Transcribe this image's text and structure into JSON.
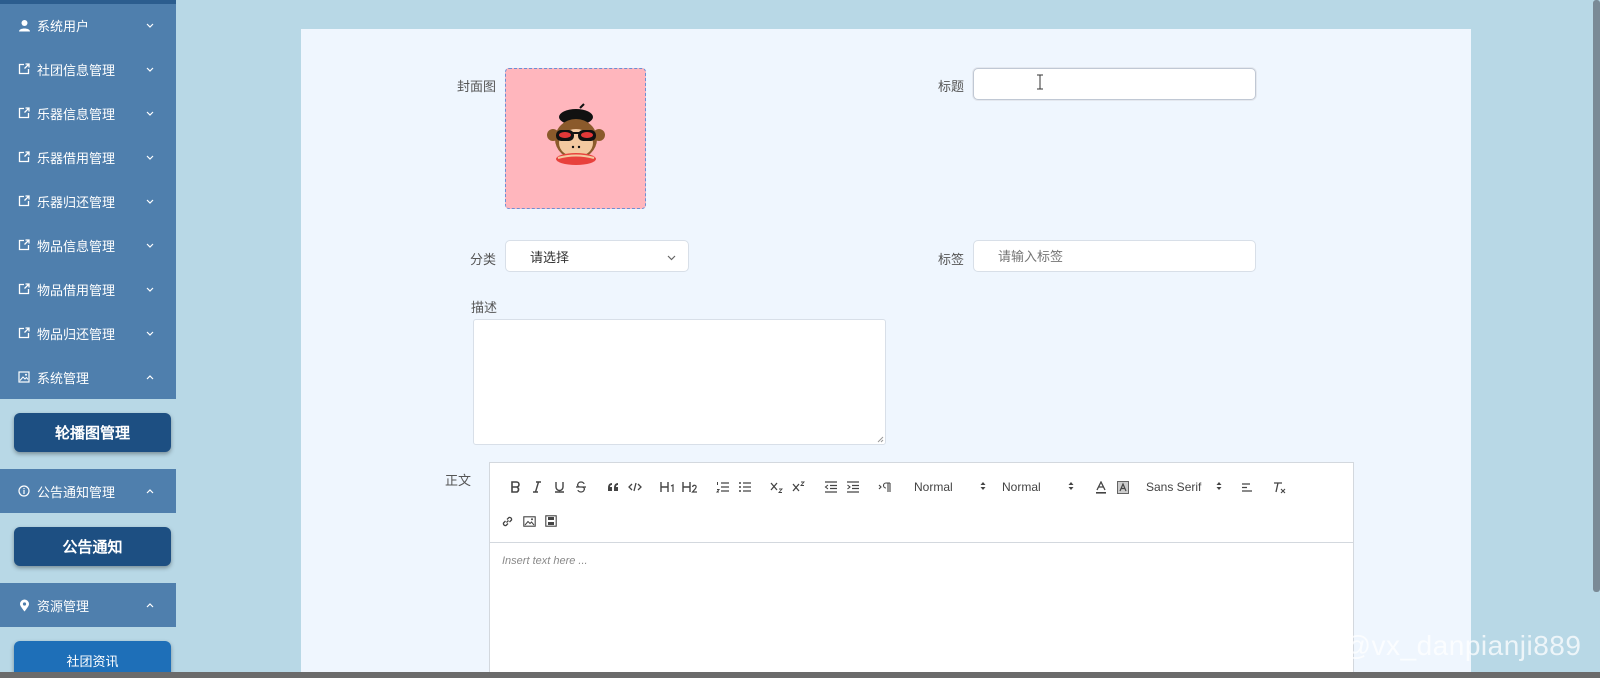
{
  "sidebar": {
    "items": [
      {
        "label": "系统用户",
        "icon": "user-icon",
        "chevron": "down"
      },
      {
        "label": "社团信息管理",
        "icon": "external-link-icon",
        "chevron": "down"
      },
      {
        "label": "乐器信息管理",
        "icon": "external-link-icon",
        "chevron": "down"
      },
      {
        "label": "乐器借用管理",
        "icon": "external-link-icon",
        "chevron": "down"
      },
      {
        "label": "乐器归还管理",
        "icon": "external-link-icon",
        "chevron": "down"
      },
      {
        "label": "物品信息管理",
        "icon": "external-link-icon",
        "chevron": "down"
      },
      {
        "label": "物品借用管理",
        "icon": "external-link-icon",
        "chevron": "down"
      },
      {
        "label": "物品归还管理",
        "icon": "external-link-icon",
        "chevron": "down"
      },
      {
        "label": "系统管理",
        "icon": "picture-icon",
        "chevron": "up"
      },
      {
        "label": "公告通知管理",
        "icon": "info-circle-icon",
        "chevron": "up"
      },
      {
        "label": "资源管理",
        "icon": "location-pin-icon",
        "chevron": "up"
      }
    ],
    "submenu": {
      "carousel": "轮播图管理",
      "notice": "公告通知",
      "news": "社团资讯"
    }
  },
  "form": {
    "cover_label": "封面图",
    "title_label": "标题",
    "title_value": "",
    "category_label": "分类",
    "category_value": "请选择",
    "tags_label": "标签",
    "tags_placeholder": "请输入标签",
    "description_label": "描述",
    "description_value": "",
    "body_label": "正文"
  },
  "editor": {
    "pickers": {
      "header": "Normal",
      "size": "Normal",
      "font": "Sans Serif"
    },
    "placeholder": "Insert text here ..."
  },
  "watermark": "CSDN @vx_danpianji889",
  "colors": {
    "sidebar_bg": "#4f7fad",
    "page_bg": "#b8d8e6",
    "panel_bg": "#eff6fe",
    "submenu_button": "#1d4f82",
    "cover_bg": "#ffb6bd"
  }
}
